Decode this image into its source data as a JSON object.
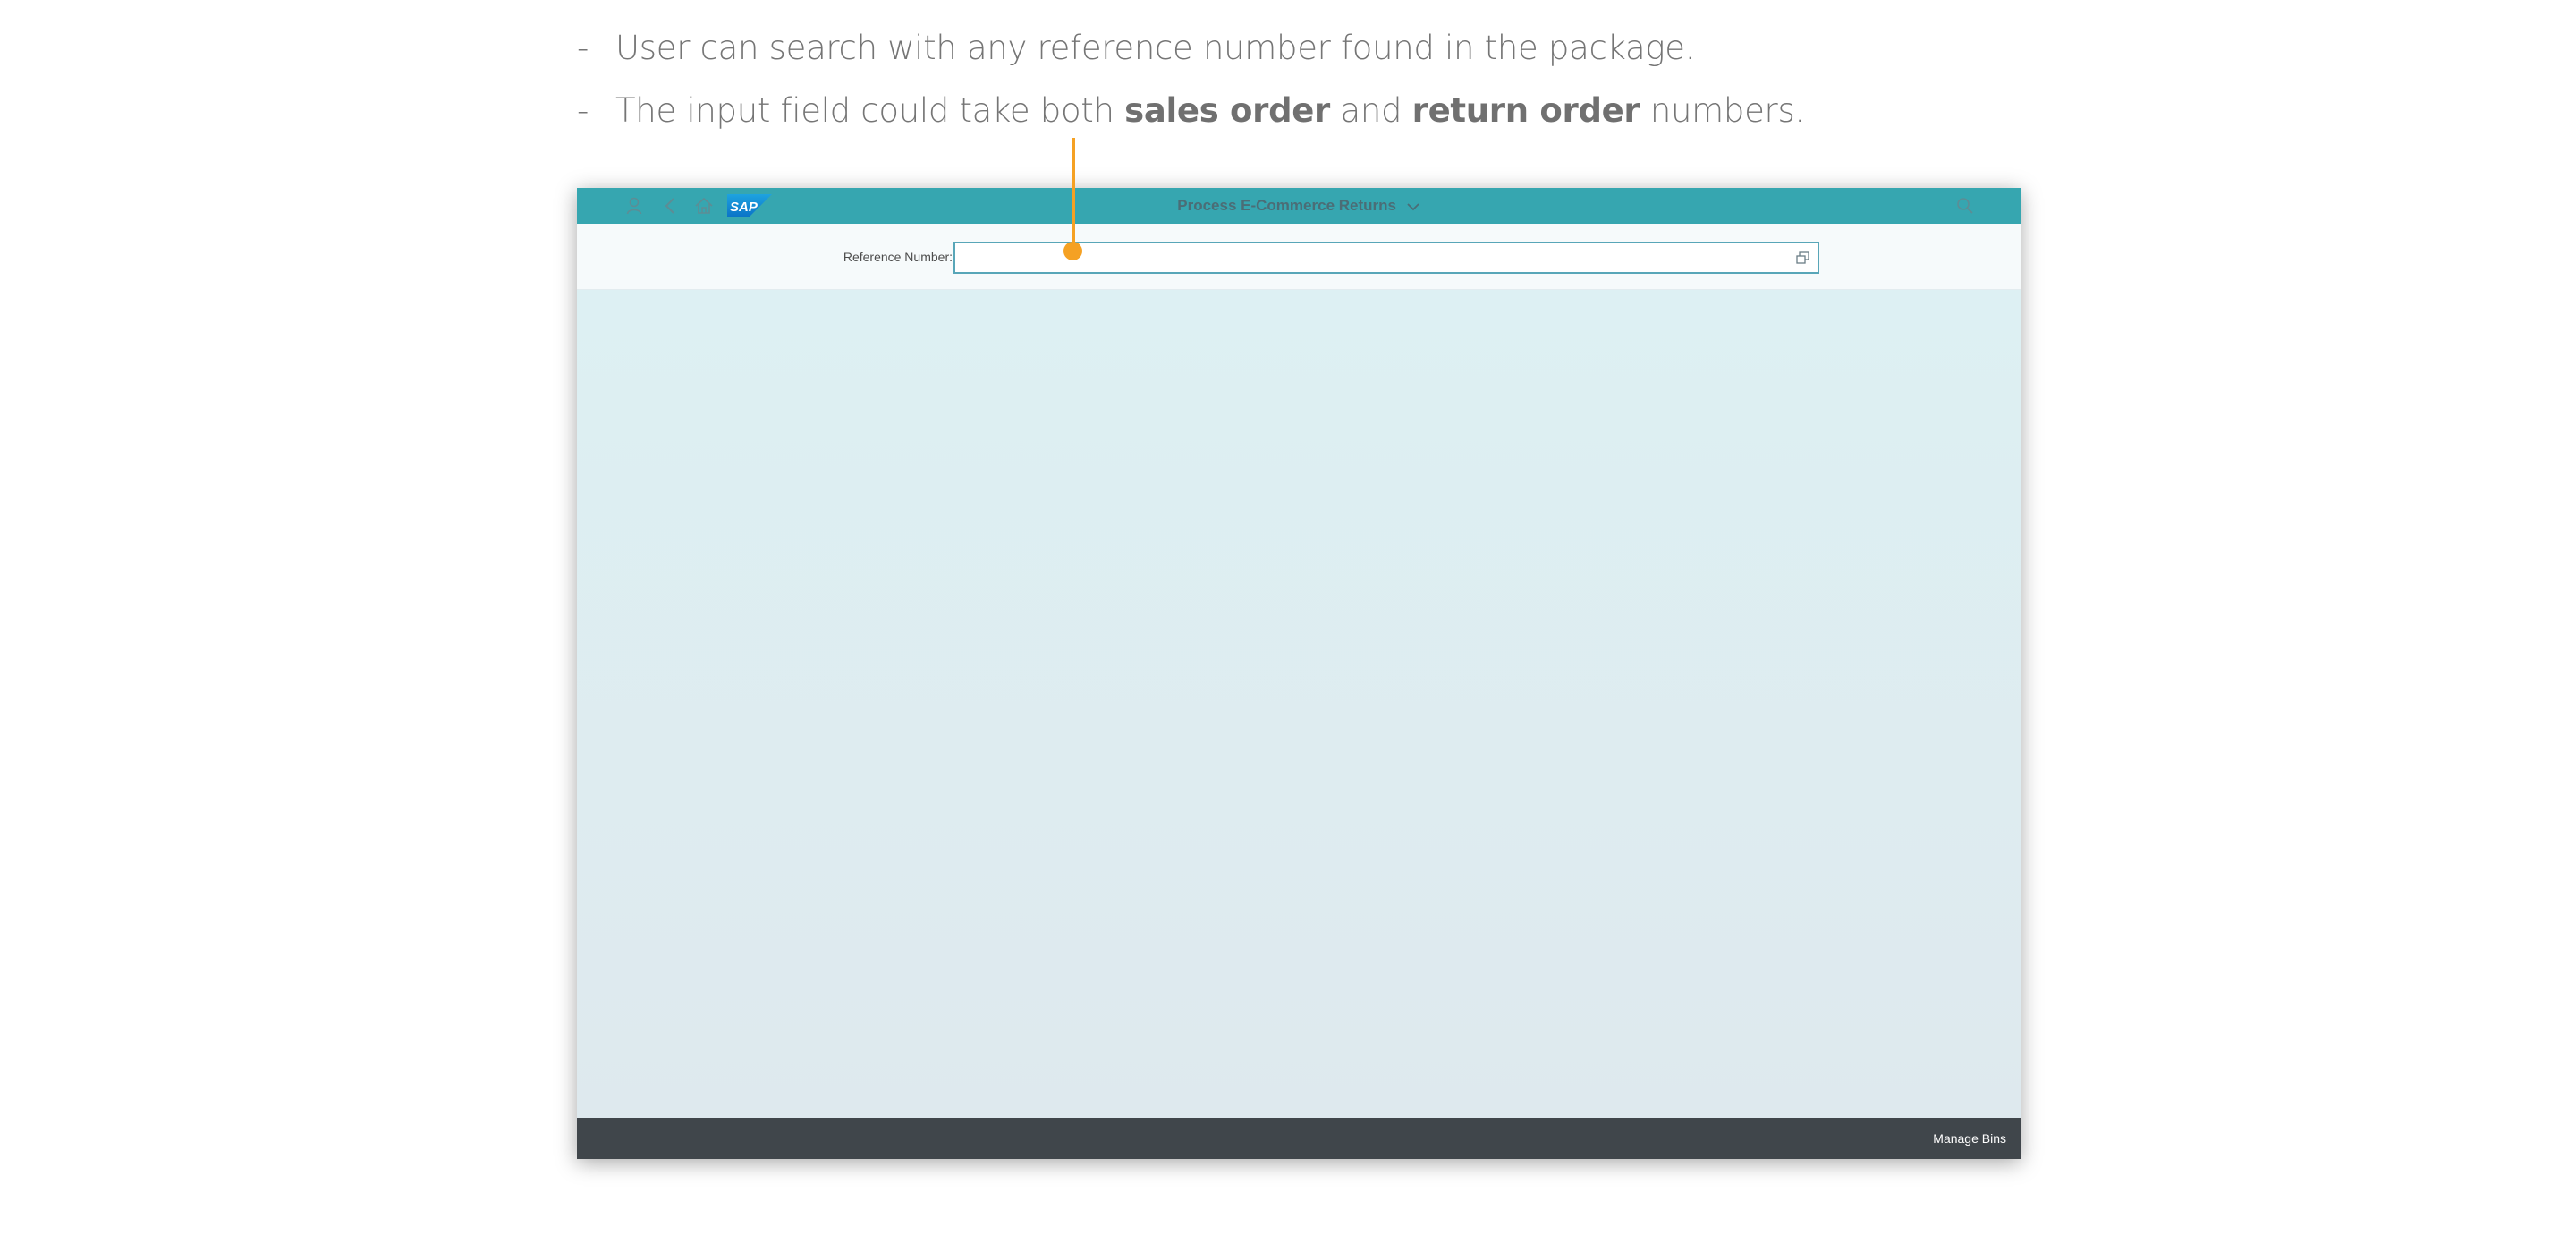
{
  "notes": [
    {
      "text": "User can search with any reference number found in the package."
    },
    {
      "prefix": "The input field could take both ",
      "bold1": "sales order",
      "middle": " and ",
      "bold2": "return order",
      "suffix": " numbers."
    }
  ],
  "shellbar": {
    "title": "Process E-Commerce Returns",
    "logo_text": "SAP",
    "icons": [
      "user-icon",
      "back-icon",
      "home-icon",
      "search-icon"
    ],
    "color": "#36a6b0"
  },
  "filter": {
    "label": "Reference Number:",
    "input_value": "",
    "input_placeholder": ""
  },
  "footer": {
    "manage_bins_label": "Manage Bins",
    "color": "#40464b"
  },
  "accent_color": "#f5a123"
}
